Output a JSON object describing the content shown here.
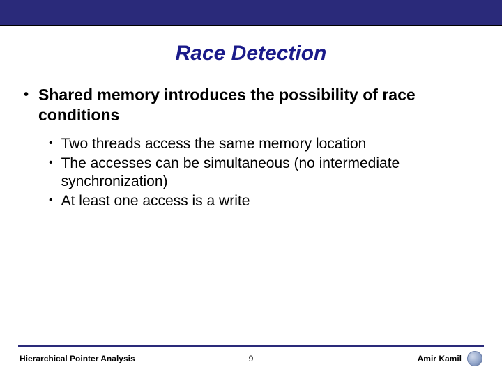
{
  "title": "Race Detection",
  "main_bullet": "Shared memory introduces the possibility of race conditions",
  "sub_bullets": [
    "Two threads access the same memory location",
    "The accesses can be simultaneous (no intermediate synchronization)",
    "At least one access is a write"
  ],
  "footer": {
    "left": "Hierarchical Pointer Analysis",
    "center": "9",
    "right": "Amir Kamil"
  }
}
